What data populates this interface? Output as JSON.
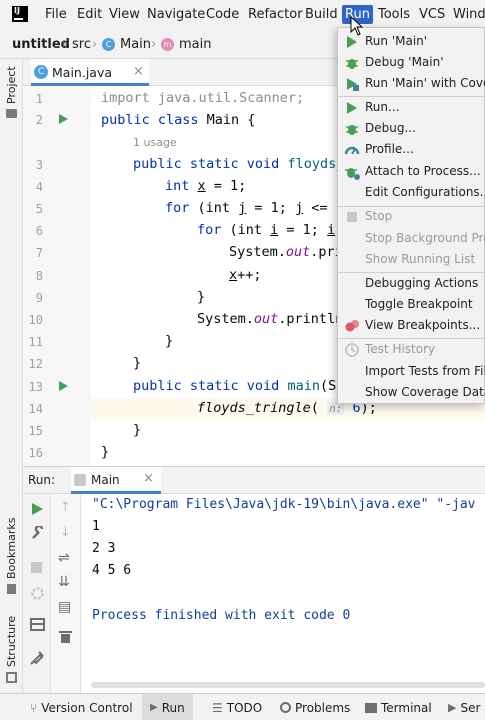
{
  "menubar": {
    "logo": "IJ",
    "items": [
      "File",
      "Edit",
      "View",
      "Navigate",
      "Code",
      "Refactor",
      "Build",
      "Run",
      "Tools",
      "VCS",
      "Windo"
    ]
  },
  "breadcrumb": {
    "project": "untitled",
    "src": "src",
    "class": "Main",
    "method": "main"
  },
  "sidebar": {
    "project": "Project",
    "bookmarks": "Bookmarks",
    "structure": "Structure"
  },
  "editor": {
    "tab": "Main.java",
    "line_numbers": [
      "1",
      "2",
      "3",
      "4",
      "5",
      "6",
      "7",
      "8",
      "9",
      "10",
      "11",
      "12",
      "13",
      "14",
      "15",
      "16"
    ],
    "usage_hint": "1 usage",
    "param_hint": "n:",
    "lines": {
      "l1": "import java.util.Scanner;",
      "l2a": "public class ",
      "l2b": "Main {",
      "l3a": "public static void ",
      "l3b": "floyds_",
      "l4a": "int ",
      "l4b": "x",
      "l4c": " = 1;",
      "l5a": "for ",
      "l5b": "(int ",
      "l5c": "j",
      "l5d": " = 1; ",
      "l5e": "j",
      "l5f": " <= n",
      "l6a": "for ",
      "l6b": "(int ",
      "l6c": "i",
      "l6d": " = 1; ",
      "l6e": "i",
      "l7a": "System.",
      "l7b": "out",
      "l7c": ".pri",
      "l8a": "x",
      "l8b": "++;",
      "l9": "}",
      "l10a": "System.",
      "l10b": "out",
      "l10c": ".println",
      "l11": "}",
      "l12": "}",
      "l13a": "public static void ",
      "l13b": "main",
      "l13c": "(St",
      "l14a": "floyds_tringle",
      "l14b": "(",
      "l14c": "6",
      "l14d": ");",
      "l15": "}",
      "l16": "}"
    }
  },
  "run_panel": {
    "label": "Run:",
    "config": "Main",
    "output": {
      "command": "\"C:\\Program Files\\Java\\jdk-19\\bin\\java.exe\" \"-jav",
      "row1": "1",
      "row2": "2 3",
      "row3": "4 5 6",
      "finished": "Process finished with exit code 0"
    }
  },
  "bottom_tabs": {
    "version_control": "Version Control",
    "run": "Run",
    "todo": "TODO",
    "problems": "Problems",
    "terminal": "Terminal",
    "services": "Ser"
  },
  "run_menu": {
    "run_main": "Run 'Main'",
    "debug_main": "Debug 'Main'",
    "run_coverage": "Run 'Main' with Covera",
    "run": "Run...",
    "debug": "Debug...",
    "profile": "Profile...",
    "attach": "Attach to Process...",
    "edit_configs": "Edit Configurations...",
    "stop": "Stop",
    "stop_background": "Stop Background Proc",
    "show_running": "Show Running List",
    "debug_actions": "Debugging Actions",
    "toggle_breakpoint": "Toggle Breakpoint",
    "view_breakpoints": "View Breakpoints...",
    "test_history": "Test History",
    "import_tests": "Import Tests from File...",
    "show_coverage": "Show Coverage Data..."
  },
  "colors": {
    "accent": "#2f65ca",
    "run_green": "#499c54",
    "keyword": "#0033b3",
    "string": "#067d17",
    "field": "#871094"
  }
}
